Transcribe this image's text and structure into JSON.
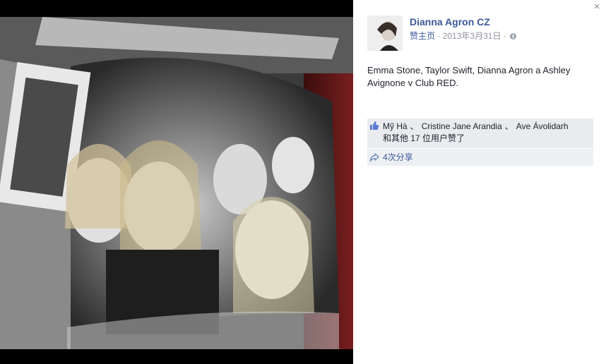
{
  "theme": {
    "link_color": "#3b5998",
    "meta_color": "#90949c",
    "likes_bg": "#e9ebee"
  },
  "photo": {
    "icon": "photo-booth-picture"
  },
  "viewer": {
    "close_label": "×",
    "close_icon": "close-icon"
  },
  "post": {
    "author": "Dianna Agron CZ",
    "meta_like_page": "赞主页",
    "meta_separator": "·",
    "meta_date": "2013年3月31日",
    "meta_separator2": "·",
    "privacy_icon": "globe-icon",
    "caption": "Emma Stone, Taylor Swift, Dianna Agron a Ashley Avignone v Club RED."
  },
  "likes": {
    "icon": "thumbs-up-icon",
    "people": [
      "Mỹ Hà",
      "Cristine Jane Arandia",
      "Ave Ávolidarh"
    ],
    "separator": "、",
    "more_prefix": "和其他 ",
    "more_count": "17 位用户",
    "more_suffix": "赞了"
  },
  "shares": {
    "icon": "share-arrow-icon",
    "text": "4次分享"
  }
}
